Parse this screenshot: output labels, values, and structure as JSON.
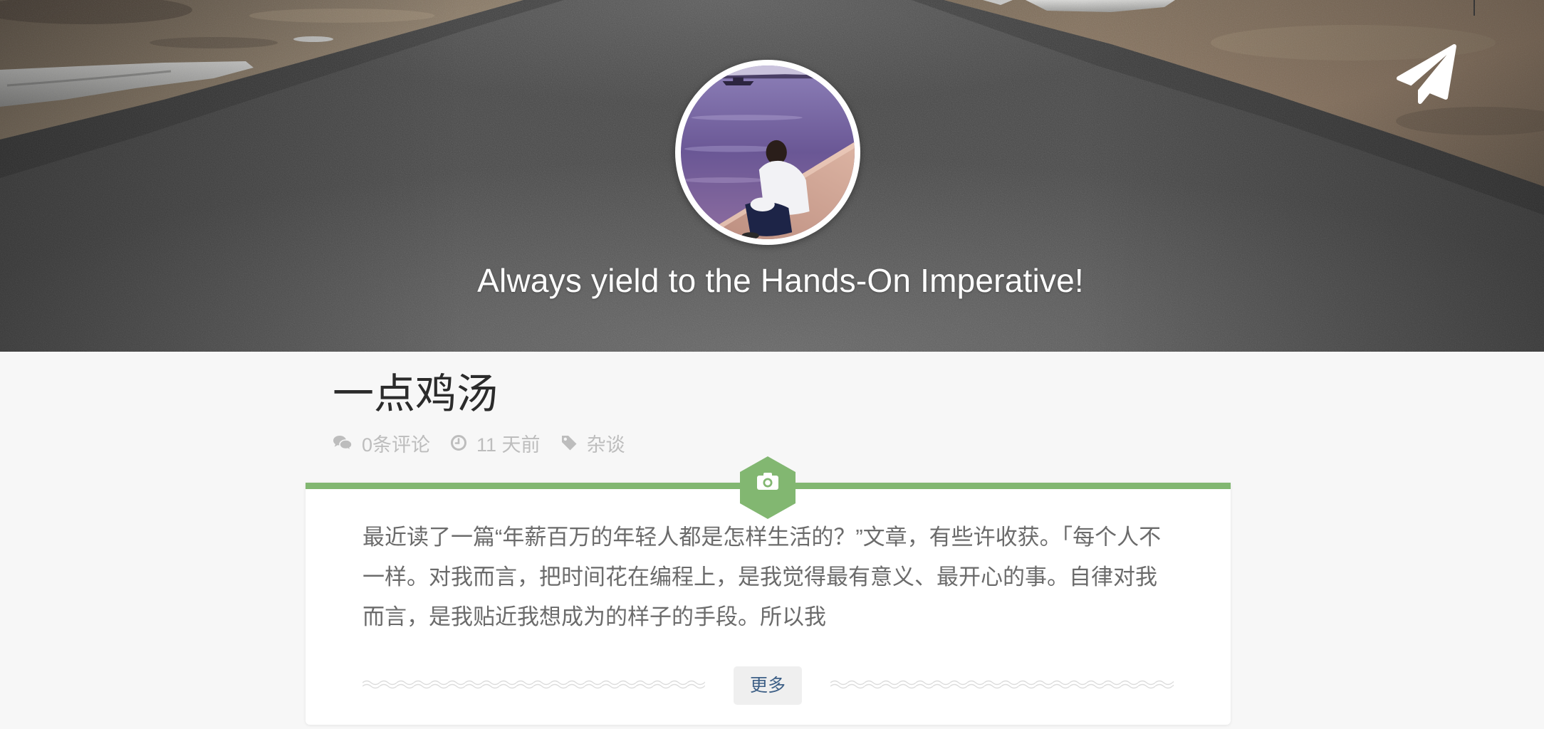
{
  "header": {
    "tagline": "Always yield to the Hands-On Imperative!",
    "avatar_icon": "avatar-photo",
    "action_icon": "paper-plane-icon"
  },
  "post": {
    "title": "一点鸡汤",
    "meta": {
      "comments_icon": "comments-icon",
      "comments": "0条评论",
      "time_icon": "clock-icon",
      "time": "11 天前",
      "category_icon": "tag-icon",
      "category": "杂谈"
    },
    "badge_icon": "camera-icon",
    "excerpt": "最近读了一篇“年薪百万的年轻人都是怎样生活的？”文章，有些许收获。「每个人不一样。对我而言，把时间花在编程上，是我觉得最有意义、最开心的事。自律对我而言，是我贴近我想成为的样子的手段。所以我",
    "more_label": "更多"
  },
  "colors": {
    "accent": "#82b771",
    "page_background": "#f7f7f7",
    "card_background": "#ffffff",
    "tagline_text": "#ffffff",
    "title": "#2b2b2b",
    "meta_text": "#bdbdbd",
    "excerpt_text": "#6b6b6b",
    "more_button_text": "#3d5f86",
    "more_button_background": "#efefef",
    "wave_line": "#dcdcdc"
  }
}
